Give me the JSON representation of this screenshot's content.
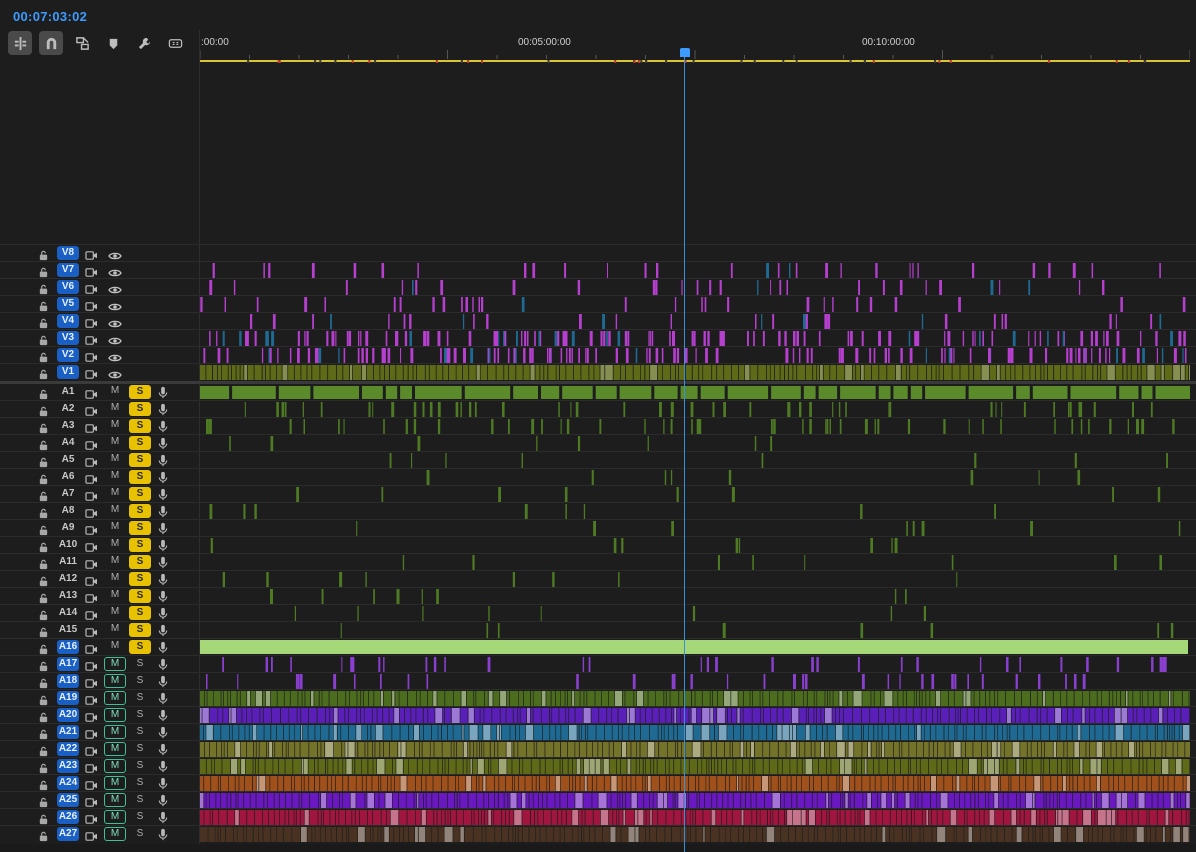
{
  "timeline": {
    "timecode": "00:07:03:02",
    "ruler_labels": [
      ":00:00",
      "00:05:00:00",
      "00:10:00:00"
    ],
    "playhead_fraction": 0.4886
  },
  "toolbar": {
    "tools": [
      {
        "name": "insert-sequence-icon",
        "active": true
      },
      {
        "name": "snap-magnet-icon",
        "active": true
      },
      {
        "name": "linked-selection-icon",
        "active": false
      },
      {
        "name": "add-marker-icon",
        "active": false
      },
      {
        "name": "settings-wrench-icon",
        "active": false
      },
      {
        "name": "captions-icon",
        "active": false
      }
    ]
  },
  "video_tracks": [
    {
      "label": "V8",
      "color": "#b63fd0"
    },
    {
      "label": "V7",
      "color": "#b63fd0"
    },
    {
      "label": "V6",
      "color": "#b63fd0"
    },
    {
      "label": "V5",
      "color": "#b63fd0"
    },
    {
      "label": "V4",
      "color": "#b63fd0"
    },
    {
      "label": "V3",
      "color": "#b63fd0"
    },
    {
      "label": "V2",
      "color": "#b63fd0"
    },
    {
      "label": "V1",
      "color": "#5e6a17"
    }
  ],
  "audio_tracks": [
    {
      "label": "A1",
      "mute_on": false,
      "solo_on": true,
      "color": "#5a8a2a"
    },
    {
      "label": "A2",
      "mute_on": false,
      "solo_on": true,
      "color": "#4d7a22"
    },
    {
      "label": "A3",
      "mute_on": false,
      "solo_on": true,
      "color": "#4d7a22"
    },
    {
      "label": "A4",
      "mute_on": false,
      "solo_on": true,
      "color": "#4d7a22"
    },
    {
      "label": "A5",
      "mute_on": false,
      "solo_on": true,
      "color": "#4d7a22"
    },
    {
      "label": "A6",
      "mute_on": false,
      "solo_on": true,
      "color": "#4d7a22"
    },
    {
      "label": "A7",
      "mute_on": false,
      "solo_on": true,
      "color": "#4d7a22"
    },
    {
      "label": "A8",
      "mute_on": false,
      "solo_on": true,
      "color": "#4d7a22"
    },
    {
      "label": "A9",
      "mute_on": false,
      "solo_on": true,
      "color": "#4d7a22"
    },
    {
      "label": "A10",
      "mute_on": false,
      "solo_on": true,
      "color": "#4d7a22"
    },
    {
      "label": "A11",
      "mute_on": false,
      "solo_on": true,
      "color": "#4d7a22"
    },
    {
      "label": "A12",
      "mute_on": false,
      "solo_on": true,
      "color": "#4d7a22"
    },
    {
      "label": "A13",
      "mute_on": false,
      "solo_on": true,
      "color": "#4d7a22"
    },
    {
      "label": "A14",
      "mute_on": false,
      "solo_on": true,
      "color": "#4d7a22"
    },
    {
      "label": "A15",
      "mute_on": false,
      "solo_on": true,
      "color": "#4d7a22"
    },
    {
      "label": "A16",
      "mute_on": false,
      "solo_on": true,
      "color": "#a6d87a"
    },
    {
      "label": "A17",
      "mute_on": true,
      "solo_on": false,
      "color": "#8a3fd0"
    },
    {
      "label": "A18",
      "mute_on": true,
      "solo_on": false,
      "color": "#8a3fd0"
    },
    {
      "label": "A19",
      "mute_on": true,
      "solo_on": false,
      "color": "#4c6d1e"
    },
    {
      "label": "A20",
      "mute_on": true,
      "solo_on": false,
      "color": "#5a1fb8"
    },
    {
      "label": "A21",
      "mute_on": true,
      "solo_on": false,
      "color": "#1f6a93"
    },
    {
      "label": "A22",
      "mute_on": true,
      "solo_on": false,
      "color": "#74732a"
    },
    {
      "label": "A23",
      "mute_on": true,
      "solo_on": false,
      "color": "#5e6a17"
    },
    {
      "label": "A24",
      "mute_on": true,
      "solo_on": false,
      "color": "#a0501a"
    },
    {
      "label": "A25",
      "mute_on": true,
      "solo_on": false,
      "color": "#6a18c0"
    },
    {
      "label": "A26",
      "mute_on": true,
      "solo_on": false,
      "color": "#a0163f"
    },
    {
      "label": "A27",
      "mute_on": true,
      "solo_on": false,
      "color": "#4a3222"
    }
  ],
  "labels": {
    "mute": "M",
    "solo": "S"
  }
}
